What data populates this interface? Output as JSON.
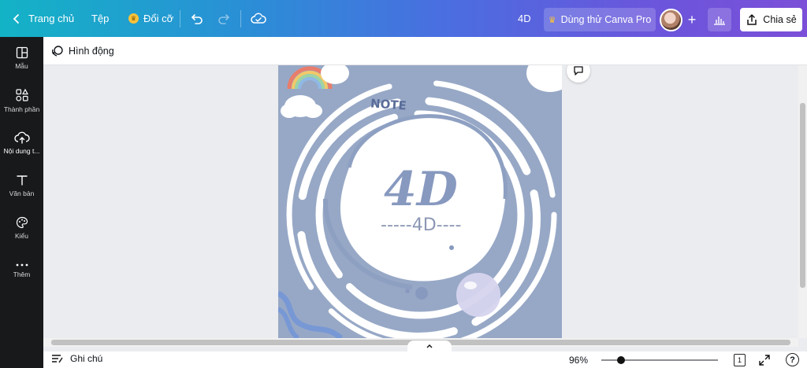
{
  "topbar": {
    "home_label": "Trang chủ",
    "file_label": "Tệp",
    "resize_label": "Đổi cỡ",
    "doc_title": "4D",
    "try_pro_label": "Dùng thử Canva Pro",
    "share_label": "Chia sẻ"
  },
  "sidebar": {
    "items": [
      {
        "label": "Mẫu",
        "icon": "template-icon"
      },
      {
        "label": "Thành phần",
        "icon": "elements-icon"
      },
      {
        "label": "Nội dung t...",
        "icon": "upload-icon"
      },
      {
        "label": "Văn bản",
        "icon": "text-icon"
      },
      {
        "label": "Kiểu",
        "icon": "palette-icon"
      },
      {
        "label": "Thêm",
        "icon": "more-icon"
      }
    ]
  },
  "subbar": {
    "animate_label": "Hình động"
  },
  "design": {
    "note_text": "NOTE",
    "big_text": "4D",
    "sub_text": "-----4D----",
    "background_color": "#97a8c6"
  },
  "bottombar": {
    "notes_label": "Ghi chú",
    "zoom_value": "96%",
    "page_count": "1",
    "help_label": "?"
  },
  "colors": {
    "topbar_start": "#13b3c6",
    "topbar_end": "#7b4fd8",
    "sidebar_bg": "#18191b",
    "crown": "#f7c23a"
  }
}
